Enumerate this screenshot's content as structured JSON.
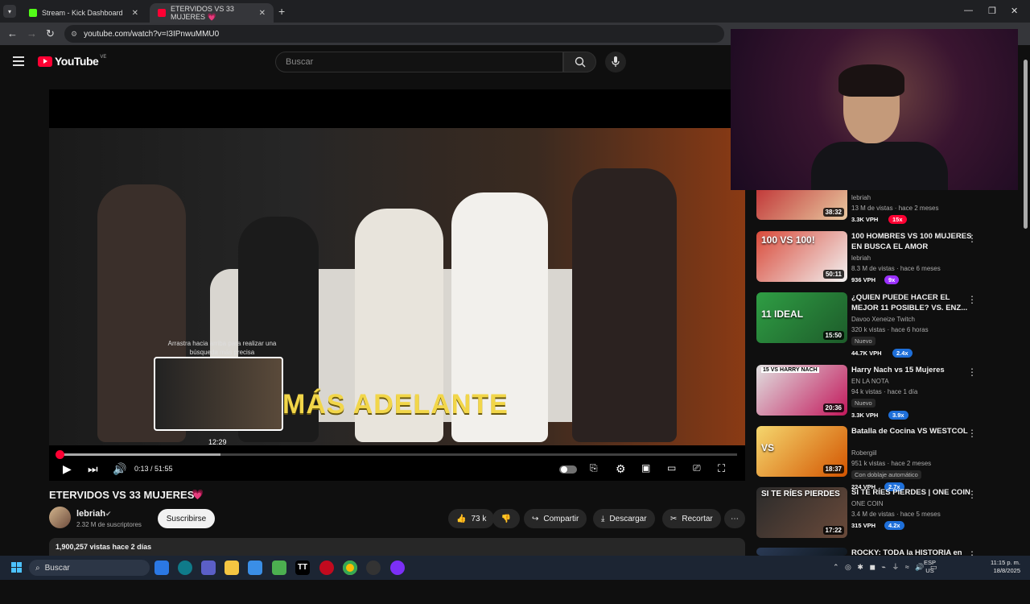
{
  "browser": {
    "tabs": [
      {
        "title": "Stream - Kick Dashboard",
        "fav_color": "#53fc18"
      },
      {
        "title": "ETERVIDOS VS 33 MUJERES 💗",
        "fav_color": "#ff0033"
      }
    ],
    "new_tab": "+",
    "close": "✕",
    "url": "youtube.com/watch?v=I3IPnwuMMU0",
    "window_buttons": {
      "minimize": "—",
      "restore": "❐",
      "close": "✕"
    }
  },
  "youtube": {
    "logo_text": "YouTube",
    "country_code": "VE",
    "search_placeholder": "Buscar"
  },
  "player": {
    "overlay_text": "MÁS ADELANTE",
    "preview_hint": "Arrastra hacia arriba para realizar una búsqueda más precisa",
    "preview_time": "12:29",
    "timecode": "0:13 / 51:55",
    "progress_fraction": 0.004,
    "hover_fraction": 0.24
  },
  "video": {
    "title": "ETERVIDOS VS 33 MUJERES",
    "title_emoji": "💗",
    "channel": "lebriah",
    "subscribers": "2.32 M de suscriptores",
    "subscribe_label": "Suscribirse",
    "likes": "73 k",
    "share_label": "Compartir",
    "download_label": "Descargar",
    "clip_label": "Recortar",
    "views_line": "1,900,257 vistas  hace 2 días"
  },
  "sidebar": [
    {
      "title": "",
      "channel": "lebriah",
      "meta": "13 M de vistas · hace 2 meses",
      "duration": "38:32",
      "vph": "3.3K VPH",
      "mult": "15x",
      "mult_color": "#ff0033",
      "badge": ""
    },
    {
      "title": "100 HOMBRES VS 100 MUJERES EN BUSCA EL AMOR",
      "channel": "lebriah",
      "meta": "8.3 M de vistas · hace 6 meses",
      "duration": "50:11",
      "vph": "936 VPH",
      "mult": "9x",
      "mult_color": "#9b30ff",
      "badge": ""
    },
    {
      "title": "¿QUIEN PUEDE HACER EL MEJOR 11 POSIBLE? VS. ENZ...",
      "channel": "Davoo Xeneize Twitch",
      "meta": "320 k vistas · hace 6 horas",
      "duration": "15:50",
      "vph": "44.7K VPH",
      "mult": "2.4x",
      "mult_color": "#1e6fd9",
      "badge": "Nuevo"
    },
    {
      "title": "Harry Nach vs 15 Mujeres",
      "channel": "EN LA NOTA",
      "meta": "94 k vistas · hace 1 día",
      "duration": "20:36",
      "vph": "3.3K VPH",
      "mult": "3.9x",
      "mult_color": "#1e6fd9",
      "badge": "Nuevo"
    },
    {
      "title": "Batalla de Cocina VS WESTCOL",
      "channel": "Robergiil",
      "meta": "951 k vistas · hace 2 meses",
      "duration": "18:37",
      "vph": "224 VPH",
      "mult": "2.7x",
      "mult_color": "#1e6fd9",
      "badge": "Con doblaje automático"
    },
    {
      "title": "SI TE RÍES PIERDES | ONE COIN",
      "channel": "ONE COIN",
      "meta": "3.4 M de vistas · hace 5 meses",
      "duration": "17:22",
      "vph": "315 VPH",
      "mult": "4.2x",
      "mult_color": "#1e6fd9",
      "badge": ""
    },
    {
      "title": "ROCKY: TODA la HISTORIA en",
      "channel": "",
      "meta": "",
      "duration": "",
      "vph": "",
      "mult": "",
      "mult_color": "#1e6fd9",
      "badge": ""
    }
  ],
  "thumb_texts": [
    "",
    "100 VS 100!",
    "11 IDEAL",
    "15 VS HARRY NACH",
    "VS",
    "SI TE RÍES PIERDES"
  ],
  "taskbar": {
    "search_label": "Buscar",
    "lang": "ESP",
    "region": "US",
    "time": "11:15 p. m.",
    "date": "18/8/2025"
  }
}
